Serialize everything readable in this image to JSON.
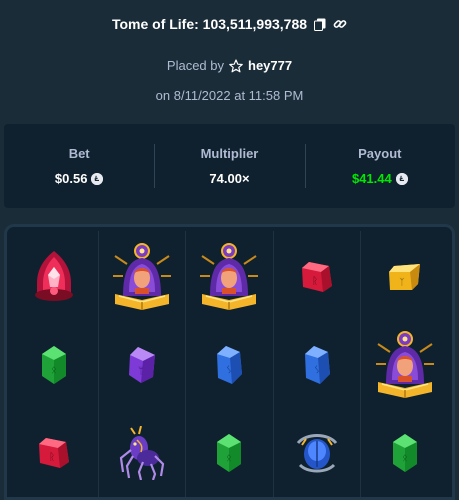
{
  "header": {
    "game_title": "Tome of Life: 103,511,993,788",
    "copy_icon": "copy-icon",
    "link_icon": "link-icon",
    "placed_by_label": "Placed by",
    "user_icon": "star-outline-icon",
    "username": "hey777",
    "date_text": "on 8/11/2022 at 11:58 PM"
  },
  "stats": {
    "bet_label": "Bet",
    "bet_value": "$0.56",
    "multiplier_label": "Multiplier",
    "multiplier_value": "74.00×",
    "payout_label": "Payout",
    "payout_value": "$41.44",
    "currency_icon": "litecoin-icon"
  },
  "colors": {
    "background": "#1a2c38",
    "panel": "#0f212e",
    "muted_text": "#b1bad3",
    "payout_green": "#00e701"
  },
  "board": {
    "columns": [
      [
        "red-gem-shrine-symbol",
        "green-gem-symbol",
        "red-gem-symbol"
      ],
      [
        "tome-wizard-symbol",
        "purple-gem-symbol",
        "spider-symbol"
      ],
      [
        "tome-wizard-symbol",
        "blue-gem-symbol",
        "green-gem-symbol"
      ],
      [
        "red-gem-symbol",
        "blue-gem-symbol",
        "scarab-symbol"
      ],
      [
        "yellow-gem-symbol",
        "tome-wizard-symbol",
        "green-gem-symbol"
      ]
    ]
  }
}
